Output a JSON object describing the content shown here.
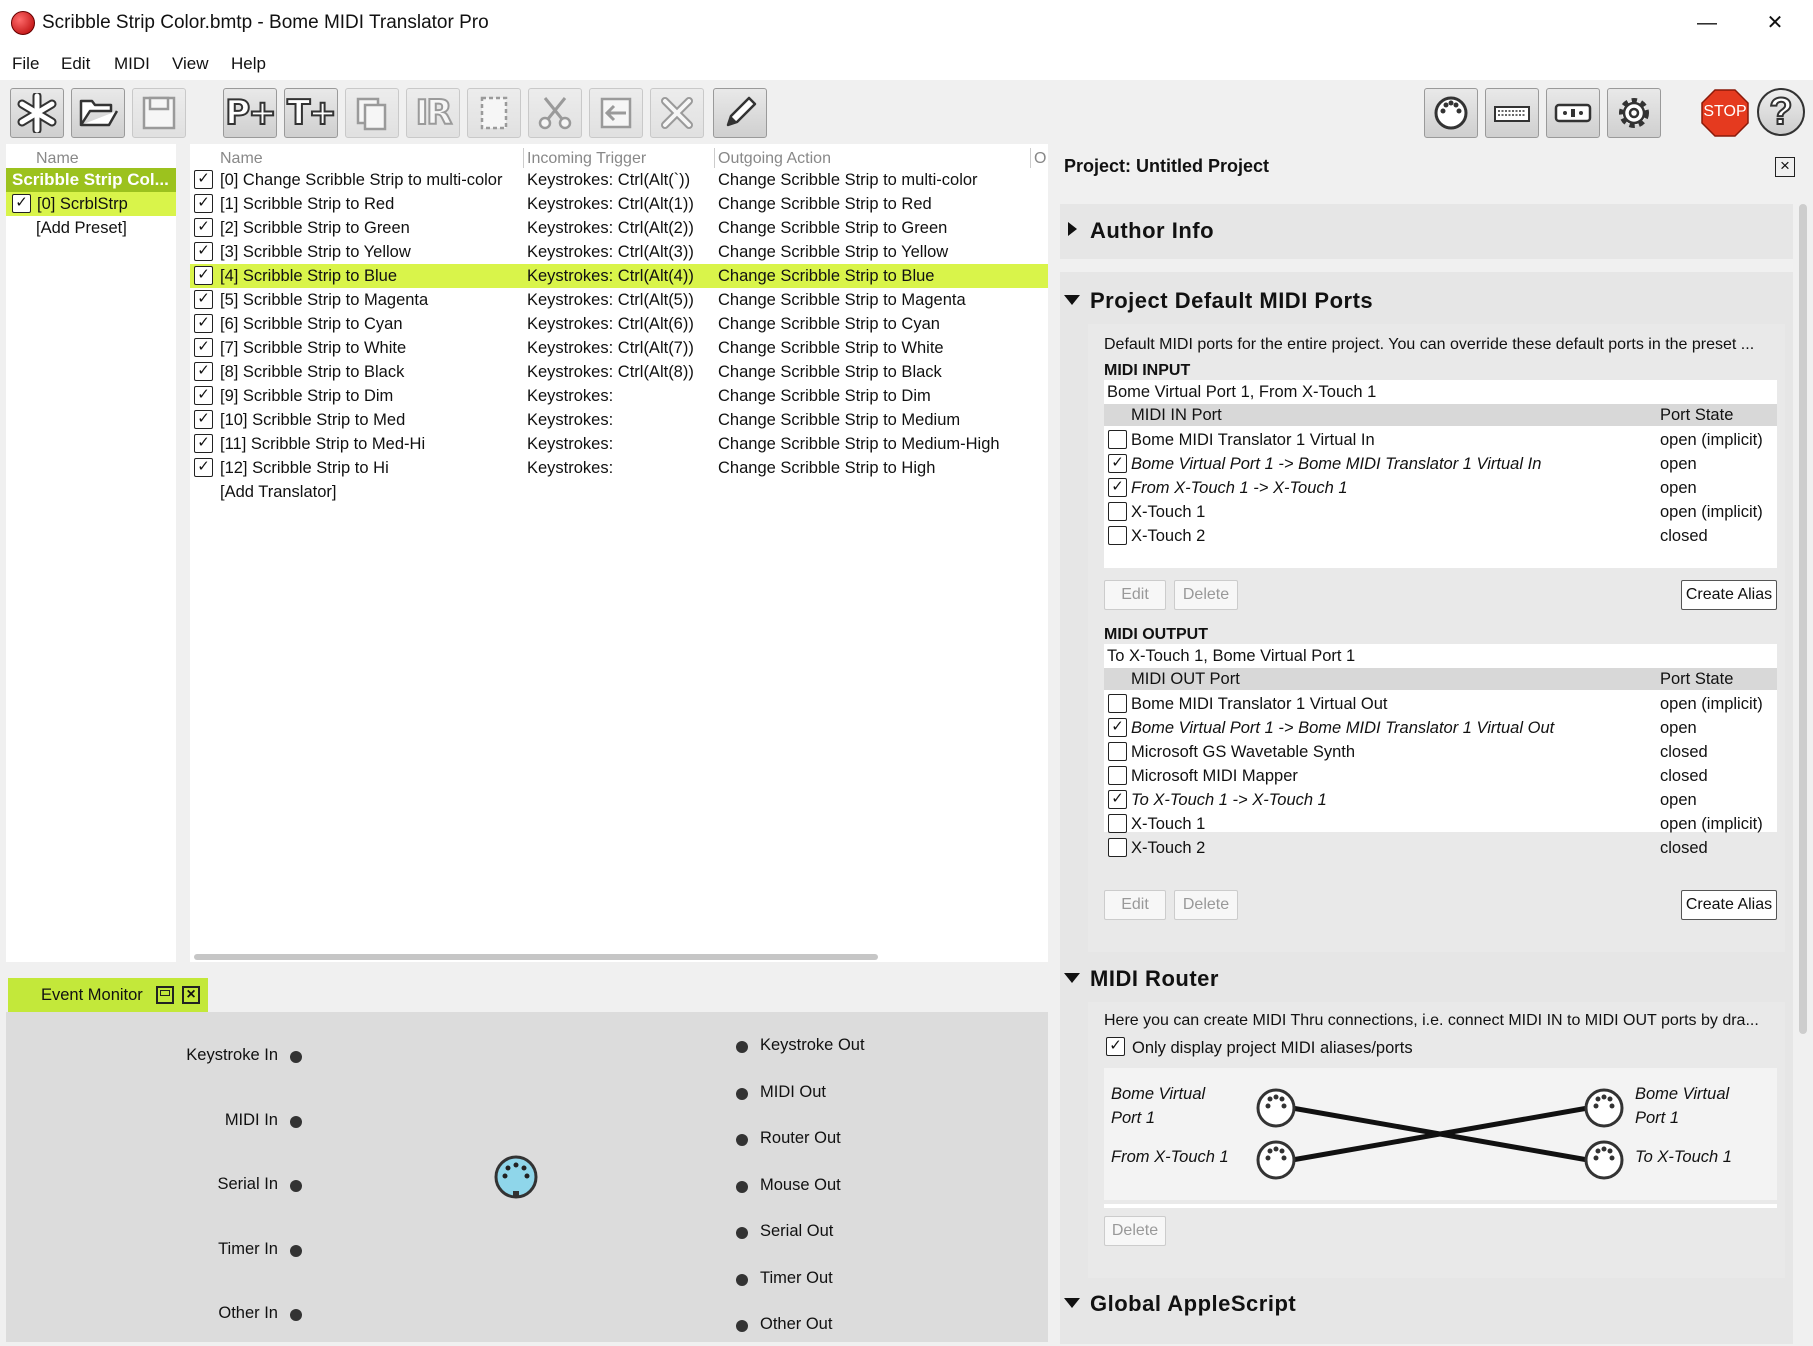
{
  "window": {
    "title": "Scribble Strip Color.bmtp - Bome MIDI Translator Pro",
    "minimize": "—",
    "maximize": "☐",
    "close": "✕"
  },
  "menu": [
    "File",
    "Edit",
    "MIDI",
    "View",
    "Help"
  ],
  "toolbar": {
    "new_preset": "P+",
    "new_translator": "T+",
    "incoming_rule": "IR",
    "stop": "STOP",
    "help": "?"
  },
  "presets": {
    "header": "Name",
    "project_name": "Scribble Strip Col...",
    "items": [
      {
        "label": "[0] ScrblStrp",
        "checked": true
      }
    ],
    "add_label": "[Add Preset]"
  },
  "translators": {
    "headers": {
      "name": "Name",
      "trigger": "Incoming Trigger",
      "action": "Outgoing Action",
      "extra": "O"
    },
    "rows": [
      {
        "name": "[0] Change Scribble Strip to multi-color",
        "trigger": "Keystrokes: Ctrl(Alt(`))",
        "action": "Change Scribble Strip to multi-color"
      },
      {
        "name": "[1] Scribble Strip to Red",
        "trigger": "Keystrokes: Ctrl(Alt(1))",
        "action": "Change Scribble Strip to Red"
      },
      {
        "name": "[2] Scribble Strip to Green",
        "trigger": "Keystrokes: Ctrl(Alt(2))",
        "action": "Change Scribble Strip to Green"
      },
      {
        "name": "[3] Scribble Strip to Yellow",
        "trigger": "Keystrokes: Ctrl(Alt(3))",
        "action": "Change Scribble Strip to Yellow"
      },
      {
        "name": "[4] Scribble Strip to Blue",
        "trigger": "Keystrokes: Ctrl(Alt(4))",
        "action": "Change Scribble Strip to Blue",
        "selected": true
      },
      {
        "name": "[5] Scribble Strip to Magenta",
        "trigger": "Keystrokes: Ctrl(Alt(5))",
        "action": "Change Scribble Strip to Magenta"
      },
      {
        "name": "[6] Scribble Strip to Cyan",
        "trigger": "Keystrokes: Ctrl(Alt(6))",
        "action": "Change Scribble Strip to Cyan"
      },
      {
        "name": "[7] Scribble Strip to White",
        "trigger": "Keystrokes: Ctrl(Alt(7))",
        "action": "Change Scribble Strip to White"
      },
      {
        "name": "[8] Scribble Strip to Black",
        "trigger": "Keystrokes: Ctrl(Alt(8))",
        "action": "Change Scribble Strip to Black"
      },
      {
        "name": "[9] Scribble Strip to Dim",
        "trigger": "Keystrokes:",
        "action": "Change Scribble Strip to Dim"
      },
      {
        "name": "[10] Scribble Strip to Med",
        "trigger": "Keystrokes:",
        "action": "Change Scribble Strip to Medium"
      },
      {
        "name": "[11] Scribble Strip to Med-Hi",
        "trigger": "Keystrokes:",
        "action": "Change Scribble Strip to Medium-High"
      },
      {
        "name": "[12] Scribble Strip to Hi",
        "trigger": "Keystrokes:",
        "action": "Change Scribble Strip to High"
      }
    ],
    "add_label": "[Add Translator]"
  },
  "event_monitor": {
    "title": "Event Monitor",
    "inputs": [
      "Keystroke In",
      "MIDI In",
      "Serial In",
      "Timer In",
      "Other In"
    ],
    "outputs": [
      "Keystroke Out",
      "MIDI Out",
      "Router Out",
      "Mouse Out",
      "Serial Out",
      "Timer Out",
      "Other Out"
    ]
  },
  "project": {
    "title": "Project: Untitled Project",
    "author_info": "Author Info",
    "default_ports_title": "Project Default MIDI Ports",
    "default_ports_desc": "Default MIDI ports for the entire project. You can override these default ports in the preset ...",
    "midi_input": {
      "label": "MIDI INPUT",
      "summary": "Bome Virtual Port 1, From X-Touch 1",
      "col_port": "MIDI IN Port",
      "col_state": "Port State",
      "ports": [
        {
          "name": "Bome MIDI Translator 1 Virtual In",
          "state": "open (implicit)",
          "checked": false,
          "italic": false
        },
        {
          "name": "Bome Virtual Port 1 -> Bome MIDI Translator 1 Virtual In",
          "state": "open",
          "checked": true,
          "italic": true
        },
        {
          "name": "From X-Touch 1 -> X-Touch 1",
          "state": "open",
          "checked": true,
          "italic": true
        },
        {
          "name": "X-Touch 1",
          "state": "open (implicit)",
          "checked": false,
          "italic": false
        },
        {
          "name": "X-Touch 2",
          "state": "closed",
          "checked": false,
          "italic": false
        }
      ]
    },
    "midi_output": {
      "label": "MIDI OUTPUT",
      "summary": "To X-Touch 1, Bome Virtual Port 1",
      "col_port": "MIDI OUT Port",
      "col_state": "Port State",
      "ports": [
        {
          "name": "Bome MIDI Translator 1 Virtual Out",
          "state": "open (implicit)",
          "checked": false,
          "italic": false
        },
        {
          "name": "Bome Virtual Port 1 -> Bome MIDI Translator 1 Virtual Out",
          "state": "open",
          "checked": true,
          "italic": true
        },
        {
          "name": "Microsoft GS Wavetable Synth",
          "state": "closed",
          "checked": false,
          "italic": false
        },
        {
          "name": "Microsoft MIDI Mapper",
          "state": "closed",
          "checked": false,
          "italic": false
        },
        {
          "name": "To X-Touch 1 -> X-Touch 1",
          "state": "open",
          "checked": true,
          "italic": true
        },
        {
          "name": "X-Touch 1",
          "state": "open (implicit)",
          "checked": false,
          "italic": false
        },
        {
          "name": "X-Touch 2",
          "state": "closed",
          "checked": false,
          "italic": false
        }
      ]
    },
    "buttons": {
      "edit": "Edit",
      "delete": "Delete",
      "create_alias": "Create Alias"
    },
    "router_title": "MIDI Router",
    "router_desc": "Here you can create MIDI Thru connections, i.e. connect MIDI IN to MIDI OUT ports by dra...",
    "router_only_aliases": "Only display project MIDI aliases/ports",
    "router_in": [
      "Bome Virtual Port 1",
      "From X-Touch 1"
    ],
    "router_out": [
      "Bome Virtual Port 1",
      "To X-Touch 1"
    ],
    "applescript_title": "Global AppleScript"
  },
  "colors": {
    "selection": "#d9f44a",
    "stop": "#e53a1f",
    "accent": "#c3e83a"
  }
}
